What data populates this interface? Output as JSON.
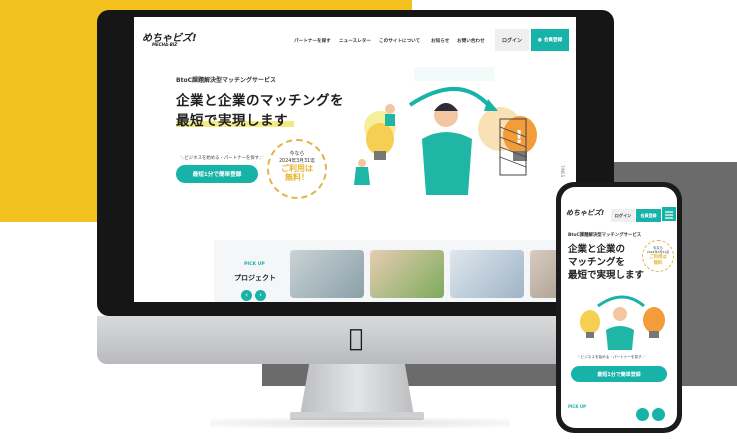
{
  "brand": {
    "logo": "めちゃビズ!",
    "logo_sub": "MECHA-BIZ"
  },
  "nav": {
    "items": [
      "パートナーを探す",
      "ニュースレター",
      "このサイトについて",
      "お知らせ",
      "お問い合わせ"
    ],
    "login": "ログイン",
    "register": "会員登録"
  },
  "hero": {
    "subtitle": "BtoC課題解決型マッチングサービス",
    "title_line1": "企業と企業のマッチングを",
    "title_line2": "最短で実現します",
    "cta_note": "＼ビジネスを始める・パートナーを探す／",
    "cta_button": "最短1分で簡単登録"
  },
  "badge": {
    "line1": "今なら",
    "line2": "2024年3月31迄",
    "line3": "ご利用は",
    "line4": "無料！"
  },
  "pickup": {
    "label": "PICK UP",
    "title": "プロジェクト"
  },
  "side_text": "TIMES",
  "phone": {
    "logo": "めちゃビズ!",
    "login": "ログイン",
    "register": "会員登録",
    "subtitle": "BtoC課題解決型マッチングサービス",
    "title_line1": "企業と企業の",
    "title_line2": "マッチングを",
    "title_line3": "最短で実現します",
    "badge_line1": "今なら",
    "badge_line2": "2024年3月31迄",
    "badge_line3": "ご利用は",
    "badge_line4": "無料",
    "cta_note": "＼ビジネスを始める・パートナーを探す／",
    "cta_button": "最短1分で簡単登録",
    "pickup_label": "PICK UP"
  },
  "colors": {
    "accent": "#18b3a8",
    "yellow": "#f2c11e",
    "gray": "#6b6b6b",
    "gold": "#e0b64a"
  }
}
